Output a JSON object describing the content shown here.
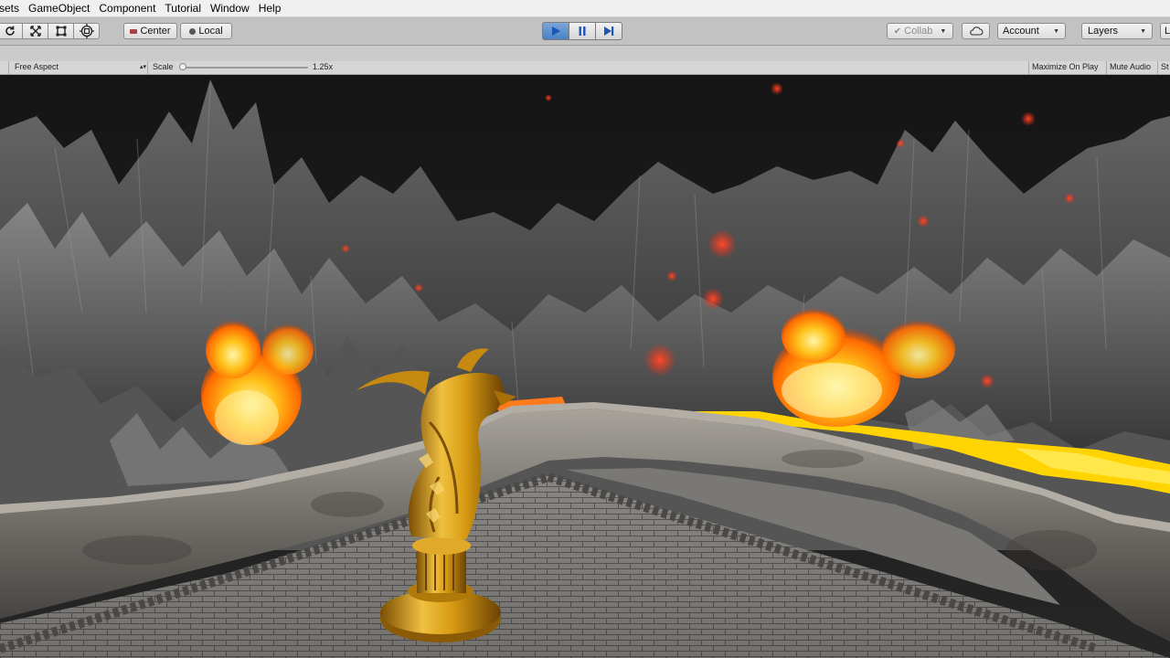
{
  "menu": [
    "sets",
    "GameObject",
    "Component",
    "Tutorial",
    "Window",
    "Help"
  ],
  "toolbar": {
    "pivot_label": "Center",
    "space_label": "Local",
    "collab_label": "Collab",
    "account_label": "Account",
    "layers_label": "Layers",
    "layout_label": "L"
  },
  "game_view": {
    "aspect_label": "Free Aspect",
    "scale_label": "Scale",
    "scale_value": "1.25x",
    "maximize_label": "Maximize On Play",
    "mute_label": "Mute Audio",
    "stats_label": "St"
  },
  "icons": {
    "tools": [
      "rotate-tool-icon",
      "scale-tool-icon",
      "rect-tool-icon",
      "transform-tool-icon"
    ],
    "play": "play-icon",
    "pause": "pause-icon",
    "step": "step-icon",
    "cloud": "cloud-icon"
  },
  "colors": {
    "play_active": "#4a80c4",
    "lava": "#ffd400",
    "fire": "#ff6a00",
    "gold": "#d79a12"
  }
}
